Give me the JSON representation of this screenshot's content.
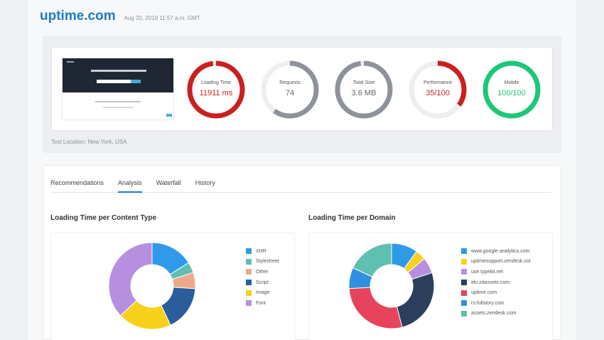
{
  "header": {
    "brand": "uptime.com",
    "date": "Aug 20, 2018 11:57 a.m. GMT"
  },
  "summary": {
    "location": "Test Location: New York, USA",
    "gauges": [
      {
        "label": "Loading Time",
        "value": "11911 ms",
        "fraction": 0.98,
        "color": "#cc1f1f",
        "value_color": "#cc1f1f"
      },
      {
        "label": "Requests",
        "value": "74",
        "fraction": 0.6,
        "color": "#8e939a",
        "value_color": "#666666"
      },
      {
        "label": "Total Size",
        "value": "3.6 MB",
        "fraction": 0.98,
        "color": "#8e939a",
        "value_color": "#666666"
      },
      {
        "label": "Performance",
        "value": "35/100",
        "fraction": 0.35,
        "color": "#cc1f1f",
        "value_color": "#cc1f1f"
      },
      {
        "label": "Mobile",
        "value": "100/100",
        "fraction": 1.0,
        "color": "#1cc77a",
        "value_color": "#1cc77a"
      }
    ]
  },
  "tabs": [
    {
      "label": "Recommendations",
      "active": false
    },
    {
      "label": "Analysis",
      "active": true
    },
    {
      "label": "Waterfall",
      "active": false
    },
    {
      "label": "History",
      "active": false
    }
  ],
  "chart_data": [
    {
      "type": "pie",
      "title": "Loading Time per Content Type",
      "categories": [
        "XHR",
        "Stylesheet",
        "Other",
        "Script",
        "Image",
        "Font"
      ],
      "values": [
        16,
        4,
        6,
        17,
        20,
        37
      ],
      "colors": [
        "#2f9be8",
        "#5fbfb0",
        "#f0a88b",
        "#2b5d9b",
        "#f7d11c",
        "#b78fe0"
      ],
      "donut": true
    },
    {
      "type": "pie",
      "title": "Loading Time per Domain",
      "categories": [
        "www.google-analytics.com",
        "uptimesupport.zendesk.cor",
        "use.typekit.net",
        "ekr.zdassets.com",
        "uptime.com",
        "rs.fullstory.com",
        "assets.zendesk.com"
      ],
      "values": [
        10,
        4,
        6,
        26,
        28,
        8,
        18
      ],
      "colors": [
        "#2f9be8",
        "#f7d11c",
        "#b78fe0",
        "#2b3f5c",
        "#e8435d",
        "#2f8fe0",
        "#5fbfb0"
      ],
      "donut": true
    }
  ]
}
